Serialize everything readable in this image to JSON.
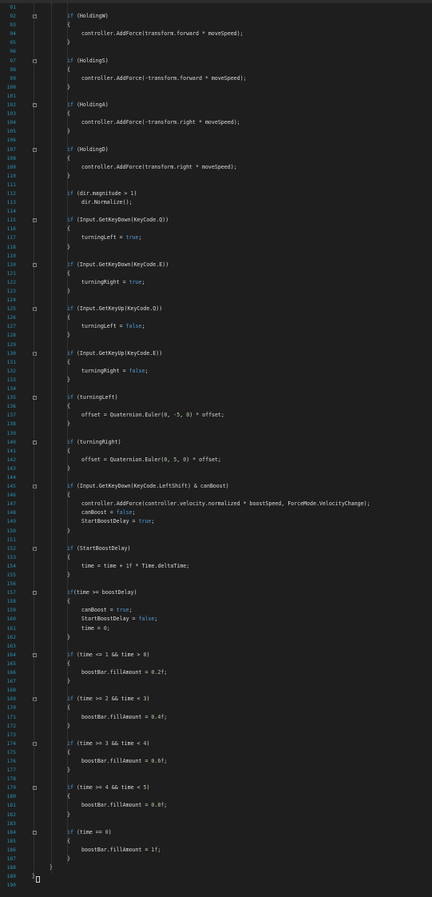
{
  "editor": {
    "theme": {
      "background": "#1e1e1e",
      "line_number_color": "#2b91af",
      "keyword_color": "#569cd6",
      "identifier_color": "#dcdcdc",
      "number_color": "#b5cea8"
    },
    "icons": {
      "fold": "collapse-minus-icon"
    },
    "lines": [
      {
        "n": "91",
        "indent": 0,
        "text": ""
      },
      {
        "n": "92",
        "indent": 2,
        "text": "if (HoldingW)",
        "fold": true
      },
      {
        "n": "93",
        "indent": 2,
        "text": "{"
      },
      {
        "n": "94",
        "indent": 3,
        "text": "controller.AddForce(transform.forward * moveSpeed);"
      },
      {
        "n": "95",
        "indent": 2,
        "text": "}"
      },
      {
        "n": "96",
        "indent": 0,
        "text": ""
      },
      {
        "n": "97",
        "indent": 2,
        "text": "if (HoldingS)",
        "fold": true
      },
      {
        "n": "98",
        "indent": 2,
        "text": "{"
      },
      {
        "n": "99",
        "indent": 3,
        "text": "controller.AddForce(-transform.forward * moveSpeed);"
      },
      {
        "n": "100",
        "indent": 2,
        "text": "}"
      },
      {
        "n": "101",
        "indent": 0,
        "text": ""
      },
      {
        "n": "102",
        "indent": 2,
        "text": "if (HoldingA)",
        "fold": true
      },
      {
        "n": "103",
        "indent": 2,
        "text": "{"
      },
      {
        "n": "104",
        "indent": 3,
        "text": "controller.AddForce(-transform.right * moveSpeed);"
      },
      {
        "n": "105",
        "indent": 2,
        "text": "}"
      },
      {
        "n": "106",
        "indent": 0,
        "text": ""
      },
      {
        "n": "107",
        "indent": 2,
        "text": "if (HoldingD)",
        "fold": true
      },
      {
        "n": "108",
        "indent": 2,
        "text": "{"
      },
      {
        "n": "109",
        "indent": 3,
        "text": "controller.AddForce(transform.right * moveSpeed);"
      },
      {
        "n": "110",
        "indent": 2,
        "text": "}"
      },
      {
        "n": "111",
        "indent": 0,
        "text": ""
      },
      {
        "n": "112",
        "indent": 2,
        "text": "if (dir.magnitude > 1)"
      },
      {
        "n": "113",
        "indent": 3,
        "text": "dir.Normalize();"
      },
      {
        "n": "114",
        "indent": 0,
        "text": ""
      },
      {
        "n": "115",
        "indent": 2,
        "text": "if (Input.GetKeyDown(KeyCode.Q))",
        "fold": true
      },
      {
        "n": "116",
        "indent": 2,
        "text": "{"
      },
      {
        "n": "117",
        "indent": 3,
        "text": "turningLeft = true;"
      },
      {
        "n": "118",
        "indent": 2,
        "text": "}"
      },
      {
        "n": "119",
        "indent": 0,
        "text": ""
      },
      {
        "n": "120",
        "indent": 2,
        "text": "if (Input.GetKeyDown(KeyCode.E))",
        "fold": true
      },
      {
        "n": "121",
        "indent": 2,
        "text": "{"
      },
      {
        "n": "122",
        "indent": 3,
        "text": "turningRight = true;"
      },
      {
        "n": "123",
        "indent": 2,
        "text": "}"
      },
      {
        "n": "124",
        "indent": 0,
        "text": ""
      },
      {
        "n": "125",
        "indent": 2,
        "text": "if (Input.GetKeyUp(KeyCode.Q))",
        "fold": true
      },
      {
        "n": "126",
        "indent": 2,
        "text": "{"
      },
      {
        "n": "127",
        "indent": 3,
        "text": "turningLeft = false;"
      },
      {
        "n": "128",
        "indent": 2,
        "text": "}"
      },
      {
        "n": "129",
        "indent": 0,
        "text": ""
      },
      {
        "n": "130",
        "indent": 2,
        "text": "if (Input.GetKeyUp(KeyCode.E))",
        "fold": true
      },
      {
        "n": "131",
        "indent": 2,
        "text": "{"
      },
      {
        "n": "132",
        "indent": 3,
        "text": "turningRight = false;"
      },
      {
        "n": "133",
        "indent": 2,
        "text": "}"
      },
      {
        "n": "134",
        "indent": 0,
        "text": ""
      },
      {
        "n": "135",
        "indent": 2,
        "text": "if (turningLeft)",
        "fold": true
      },
      {
        "n": "136",
        "indent": 2,
        "text": "{"
      },
      {
        "n": "137",
        "indent": 3,
        "text": "offset = Quaternion.Euler(0, -5, 0) * offset;"
      },
      {
        "n": "138",
        "indent": 2,
        "text": "}"
      },
      {
        "n": "139",
        "indent": 0,
        "text": ""
      },
      {
        "n": "140",
        "indent": 2,
        "text": "if (turningRight)",
        "fold": true
      },
      {
        "n": "141",
        "indent": 2,
        "text": "{"
      },
      {
        "n": "142",
        "indent": 3,
        "text": "offset = Quaternion.Euler(0, 5, 0) * offset;"
      },
      {
        "n": "143",
        "indent": 2,
        "text": "}"
      },
      {
        "n": "144",
        "indent": 0,
        "text": ""
      },
      {
        "n": "145",
        "indent": 2,
        "text": "if (Input.GetKeyDown(KeyCode.LeftShift) & canBoost)",
        "fold": true
      },
      {
        "n": "146",
        "indent": 2,
        "text": "{"
      },
      {
        "n": "147",
        "indent": 3,
        "text": "controller.AddForce(controller.velocity.normalized * boostSpeed, ForceMode.VelocityChange);"
      },
      {
        "n": "148",
        "indent": 3,
        "text": "canBoost = false;"
      },
      {
        "n": "149",
        "indent": 3,
        "text": "StartBoostDelay = true;"
      },
      {
        "n": "150",
        "indent": 2,
        "text": "}"
      },
      {
        "n": "151",
        "indent": 0,
        "text": ""
      },
      {
        "n": "152",
        "indent": 2,
        "text": "if (StartBoostDelay)",
        "fold": true
      },
      {
        "n": "153",
        "indent": 2,
        "text": "{"
      },
      {
        "n": "154",
        "indent": 3,
        "text": "time = time + 1f * Time.deltaTime;"
      },
      {
        "n": "155",
        "indent": 2,
        "text": "}"
      },
      {
        "n": "156",
        "indent": 0,
        "text": ""
      },
      {
        "n": "157",
        "indent": 2,
        "text": "if(time >= boostDelay)",
        "fold": true
      },
      {
        "n": "158",
        "indent": 2,
        "text": "{"
      },
      {
        "n": "159",
        "indent": 3,
        "text": "canBoost = true;"
      },
      {
        "n": "160",
        "indent": 3,
        "text": "StartBoostDelay = false;"
      },
      {
        "n": "161",
        "indent": 3,
        "text": "time = 0;"
      },
      {
        "n": "162",
        "indent": 2,
        "text": "}"
      },
      {
        "n": "163",
        "indent": 0,
        "text": ""
      },
      {
        "n": "164",
        "indent": 2,
        "text": "if (time <= 1 && time > 0)",
        "fold": true
      },
      {
        "n": "165",
        "indent": 2,
        "text": "{"
      },
      {
        "n": "166",
        "indent": 3,
        "text": "boostBar.fillAmount = 0.2f;"
      },
      {
        "n": "167",
        "indent": 2,
        "text": "}"
      },
      {
        "n": "168",
        "indent": 0,
        "text": ""
      },
      {
        "n": "169",
        "indent": 2,
        "text": "if (time >= 2 && time < 3)",
        "fold": true
      },
      {
        "n": "170",
        "indent": 2,
        "text": "{"
      },
      {
        "n": "171",
        "indent": 3,
        "text": "boostBar.fillAmount = 0.4f;"
      },
      {
        "n": "172",
        "indent": 2,
        "text": "}"
      },
      {
        "n": "173",
        "indent": 0,
        "text": ""
      },
      {
        "n": "174",
        "indent": 2,
        "text": "if (time >= 3 && time < 4)",
        "fold": true
      },
      {
        "n": "175",
        "indent": 2,
        "text": "{"
      },
      {
        "n": "176",
        "indent": 3,
        "text": "boostBar.fillAmount = 0.6f;"
      },
      {
        "n": "177",
        "indent": 2,
        "text": "}"
      },
      {
        "n": "178",
        "indent": 0,
        "text": ""
      },
      {
        "n": "179",
        "indent": 2,
        "text": "if (time >= 4 && time < 5)",
        "fold": true
      },
      {
        "n": "180",
        "indent": 2,
        "text": "{"
      },
      {
        "n": "181",
        "indent": 3,
        "text": "boostBar.fillAmount = 0.8f;"
      },
      {
        "n": "182",
        "indent": 2,
        "text": "}"
      },
      {
        "n": "183",
        "indent": 0,
        "text": ""
      },
      {
        "n": "184",
        "indent": 2,
        "text": "if (time == 0)",
        "fold": true
      },
      {
        "n": "185",
        "indent": 2,
        "text": "{"
      },
      {
        "n": "186",
        "indent": 3,
        "text": "boostBar.fillAmount = 1f;"
      },
      {
        "n": "187",
        "indent": 2,
        "text": "}"
      },
      {
        "n": "188",
        "indent": 1,
        "text": "}"
      },
      {
        "n": "189",
        "indent": 0,
        "text": "}"
      },
      {
        "n": "190",
        "indent": 0,
        "text": ""
      }
    ]
  }
}
